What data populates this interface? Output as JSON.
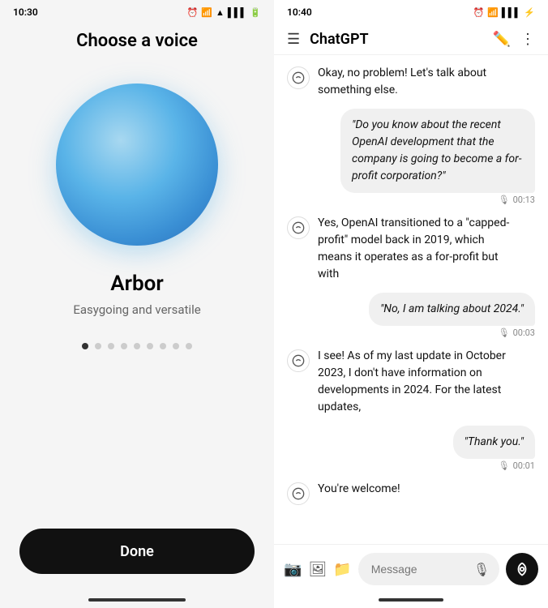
{
  "left": {
    "status_time": "10:30",
    "status_icons": [
      "alarm",
      "signal",
      "wifi",
      "bars",
      "battery"
    ],
    "page_title": "Choose a voice",
    "voice_name": "Arbor",
    "voice_description": "Easygoing and versatile",
    "dots_count": 9,
    "active_dot": 0,
    "done_button_label": "Done"
  },
  "right": {
    "status_time": "10:40",
    "status_icons": [
      "alarm",
      "wifi",
      "bars",
      "battery"
    ],
    "chat_title": "ChatGPT",
    "messages": [
      {
        "type": "bot",
        "text": "Okay, no problem! Let's talk about something else."
      },
      {
        "type": "user",
        "text": "\"Do you know about the recent OpenAI development that the company is going to become a for-profit corporation?\"",
        "time": "00:13"
      },
      {
        "type": "bot",
        "text": "Yes, OpenAI transitioned to a \"capped-profit\" model back in 2019, which means it operates as a for-profit but with"
      },
      {
        "type": "user",
        "text": "\"No, I am talking about 2024.\"",
        "time": "00:03"
      },
      {
        "type": "bot",
        "text": "I see! As of my last update in October 2023, I don't have information on developments in 2024. For the latest updates,"
      },
      {
        "type": "user",
        "text": "\"Thank you.\"",
        "time": "00:01"
      },
      {
        "type": "bot",
        "text": "You're welcome!"
      }
    ],
    "input_placeholder": "Message",
    "edit_icon": "✏️",
    "more_icon": "⋮",
    "menu_icon": "≡"
  }
}
